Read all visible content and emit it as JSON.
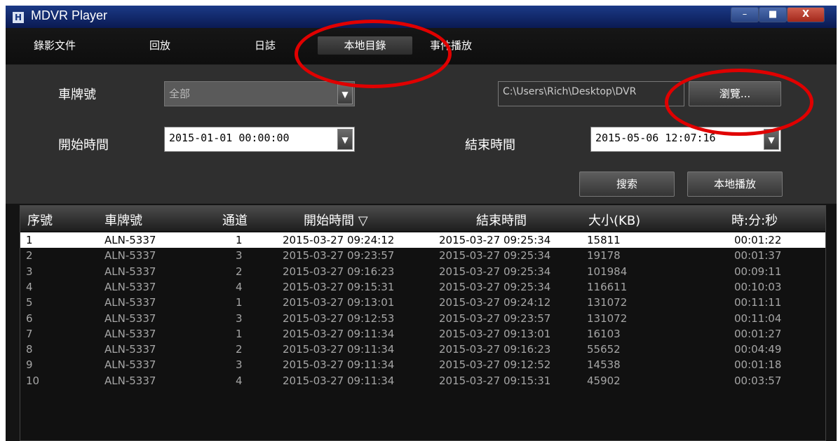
{
  "window": {
    "title": "MDVR Player",
    "app_icon": "film-icon",
    "controls": {
      "minimize": "–",
      "maximize": "■",
      "close": "X"
    }
  },
  "menu": [
    "錄影文件",
    "回放",
    "日誌",
    "本地目錄",
    "事件播放"
  ],
  "filters": {
    "plate_label": "車牌號",
    "plate_value": "全部",
    "path_value": "C:\\Users\\Rich\\Desktop\\DVR",
    "browse_label": "瀏覽...",
    "start_label": "開始時間",
    "start_value": "2015-01-01 00:00:00",
    "end_label": "結束時間",
    "end_value": "2015-05-06 12:07:16",
    "search_label": "搜索",
    "local_play_label": "本地播放"
  },
  "table": {
    "headers": [
      "序號",
      "車牌號",
      "通道",
      "開始時間 ▽",
      "結束時間",
      "大小(KB)",
      "時:分:秒"
    ],
    "selected_row": 0,
    "rows": [
      [
        "1",
        "ALN-5337",
        "1",
        "2015-03-27 09:24:12",
        "2015-03-27 09:25:34",
        "15811",
        "00:01:22"
      ],
      [
        "2",
        "ALN-5337",
        "3",
        "2015-03-27 09:23:57",
        "2015-03-27 09:25:34",
        "19178",
        "00:01:37"
      ],
      [
        "3",
        "ALN-5337",
        "2",
        "2015-03-27 09:16:23",
        "2015-03-27 09:25:34",
        "101984",
        "00:09:11"
      ],
      [
        "4",
        "ALN-5337",
        "4",
        "2015-03-27 09:15:31",
        "2015-03-27 09:25:34",
        "116611",
        "00:10:03"
      ],
      [
        "5",
        "ALN-5337",
        "1",
        "2015-03-27 09:13:01",
        "2015-03-27 09:24:12",
        "131072",
        "00:11:11"
      ],
      [
        "6",
        "ALN-5337",
        "3",
        "2015-03-27 09:12:53",
        "2015-03-27 09:23:57",
        "131072",
        "00:11:04"
      ],
      [
        "7",
        "ALN-5337",
        "1",
        "2015-03-27 09:11:34",
        "2015-03-27 09:13:01",
        "16103",
        "00:01:27"
      ],
      [
        "8",
        "ALN-5337",
        "2",
        "2015-03-27 09:11:34",
        "2015-03-27 09:16:23",
        "55652",
        "00:04:49"
      ],
      [
        "9",
        "ALN-5337",
        "3",
        "2015-03-27 09:11:34",
        "2015-03-27 09:12:52",
        "14538",
        "00:01:18"
      ],
      [
        "10",
        "ALN-5337",
        "4",
        "2015-03-27 09:11:34",
        "2015-03-27 09:15:31",
        "45902",
        "00:03:57"
      ]
    ]
  },
  "colors": {
    "annotation_ring": "#e00000",
    "selected_row_bg": "#ffffff",
    "title_bar": "#1b3a86"
  }
}
